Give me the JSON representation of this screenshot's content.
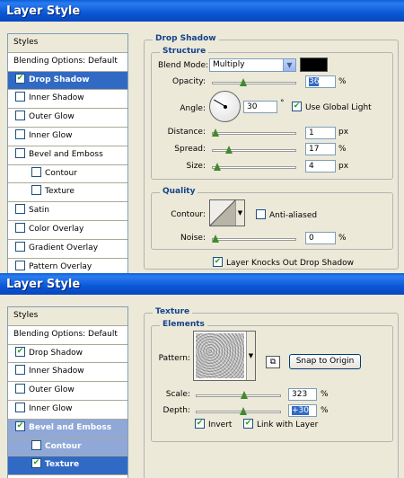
{
  "window1": {
    "title": "Layer Style",
    "styles": [
      {
        "label": "Styles",
        "type": "header"
      },
      {
        "label": "Blending Options: Default",
        "type": "plain"
      },
      {
        "label": "Drop Shadow",
        "checked": true,
        "selected": true
      },
      {
        "label": "Inner Shadow",
        "checked": false
      },
      {
        "label": "Outer Glow",
        "checked": false
      },
      {
        "label": "Inner Glow",
        "checked": false
      },
      {
        "label": "Bevel and Emboss",
        "checked": false
      },
      {
        "label": "Contour",
        "checked": false,
        "indent": true
      },
      {
        "label": "Texture",
        "checked": false,
        "indent": true
      },
      {
        "label": "Satin",
        "checked": false
      },
      {
        "label": "Color Overlay",
        "checked": false
      },
      {
        "label": "Gradient Overlay",
        "checked": false
      },
      {
        "label": "Pattern Overlay",
        "checked": false
      }
    ],
    "section_title": "Drop Shadow",
    "structure": {
      "title": "Structure",
      "blend_mode_label": "Blend Mode:",
      "blend_mode_value": "Multiply",
      "shadow_color": "#000000",
      "opacity_label": "Opacity:",
      "opacity_value": "36",
      "opacity_fraction": 0.36,
      "opacity_unit": "%",
      "angle_label": "Angle:",
      "angle_value": "30",
      "angle_unit": "°",
      "use_global_light_label": "Use Global Light",
      "use_global_light_checked": true,
      "distance_label": "Distance:",
      "distance_value": "1",
      "distance_fraction": 0.0,
      "distance_unit": "px",
      "spread_label": "Spread:",
      "spread_value": "17",
      "spread_fraction": 0.17,
      "spread_unit": "%",
      "size_label": "Size:",
      "size_value": "4",
      "size_fraction": 0.02,
      "size_unit": "px"
    },
    "quality": {
      "title": "Quality",
      "contour_label": "Contour:",
      "anti_aliased_label": "Anti-aliased",
      "anti_aliased_checked": false,
      "noise_label": "Noise:",
      "noise_value": "0",
      "noise_fraction": 0.0,
      "noise_unit": "%"
    },
    "knockout_label": "Layer Knocks Out Drop Shadow",
    "knockout_checked": true
  },
  "window2": {
    "title": "Layer Style",
    "styles": [
      {
        "label": "Styles",
        "type": "header"
      },
      {
        "label": "Blending Options: Default",
        "type": "plain"
      },
      {
        "label": "Drop Shadow",
        "checked": true
      },
      {
        "label": "Inner Shadow",
        "checked": false
      },
      {
        "label": "Outer Glow",
        "checked": false
      },
      {
        "label": "Inner Glow",
        "checked": false
      },
      {
        "label": "Bevel and Emboss",
        "checked": true,
        "softselected": true
      },
      {
        "label": "Contour",
        "checked": false,
        "indent": true,
        "softselected": true
      },
      {
        "label": "Texture",
        "checked": true,
        "indent": true,
        "selected": true
      }
    ],
    "section_title": "Texture",
    "elements": {
      "title": "Elements",
      "pattern_label": "Pattern:",
      "snap_button": "Snap to Origin",
      "scale_label": "Scale:",
      "scale_value": "323",
      "scale_fraction": 0.58,
      "scale_unit": "%",
      "depth_label": "Depth:",
      "depth_value": "+30",
      "depth_fraction": 0.56,
      "depth_unit": "%",
      "invert_label": "Invert",
      "invert_checked": true,
      "link_label": "Link with Layer",
      "link_checked": true
    }
  }
}
